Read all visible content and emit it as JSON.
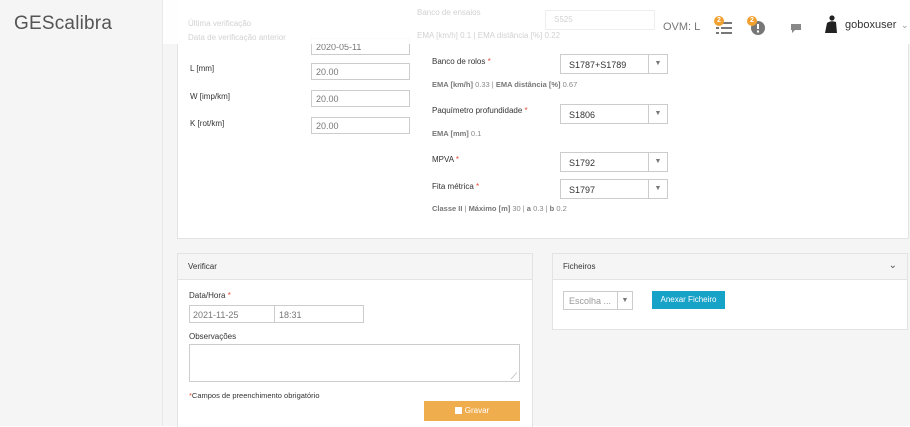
{
  "app": {
    "title": "GEScalibra"
  },
  "topbar": {
    "ovm_label": "OVM: L",
    "badge_tasks": "2",
    "badge_alerts": "2",
    "username": "goboxuser"
  },
  "faded": {
    "left_label_1": "Última verificação",
    "left_label_2": "Data de verificação anterior",
    "right_label": "Banco de ensaios",
    "right_value": "S525",
    "right_info": "EMA [km/h] 0.1 | EMA distância [%] 0.22"
  },
  "left_form": {
    "date_value": "2020-05-11",
    "fields": [
      {
        "label": "L [mm]",
        "value": "20.00"
      },
      {
        "label": "W [imp/km]",
        "value": "20.00"
      },
      {
        "label": "K [rot/km]",
        "value": "20.00"
      }
    ]
  },
  "right_form": {
    "banco_rolos": {
      "label": "Banco de rolos",
      "req": "*",
      "value": "S1787+S1789",
      "info_label": "EMA [km/h]",
      "info_value": "0.33",
      "info_label2": "EMA distância [%]",
      "info_value2": "0.67"
    },
    "paquimetro": {
      "label": "Paquímetro profundidade",
      "req": "*",
      "value": "S1806",
      "info_label": "EMA [mm]",
      "info_value": "0.1"
    },
    "mpva": {
      "label": "MPVA",
      "req": "*",
      "value": "S1792"
    },
    "fita": {
      "label": "Fita métrica",
      "req": "*",
      "value": "S1797"
    },
    "classe": {
      "classe_label": "Classe II",
      "max_label": "Máximo [m]",
      "max_value": "30",
      "a_label": "a",
      "a_value": "0.3",
      "b_label": "b",
      "b_value": "0.2"
    }
  },
  "verificar": {
    "title": "Verificar",
    "datahora_label": "Data/Hora",
    "req": "*",
    "date_value": "2021-11-25",
    "time_value": "18:31",
    "obs_label": "Observações",
    "required_note_star": "*",
    "required_note": "Campos de preenchimento obrigatório",
    "save_label": "Gravar"
  },
  "ficheiros": {
    "title": "Ficheiros",
    "select_placeholder": "Escolha ...",
    "attach_label": "Anexar Ficheiro"
  },
  "colors": {
    "accent_orange": "#f0ad4e",
    "accent_blue": "#17a2c7",
    "required": "#e74c3c"
  }
}
